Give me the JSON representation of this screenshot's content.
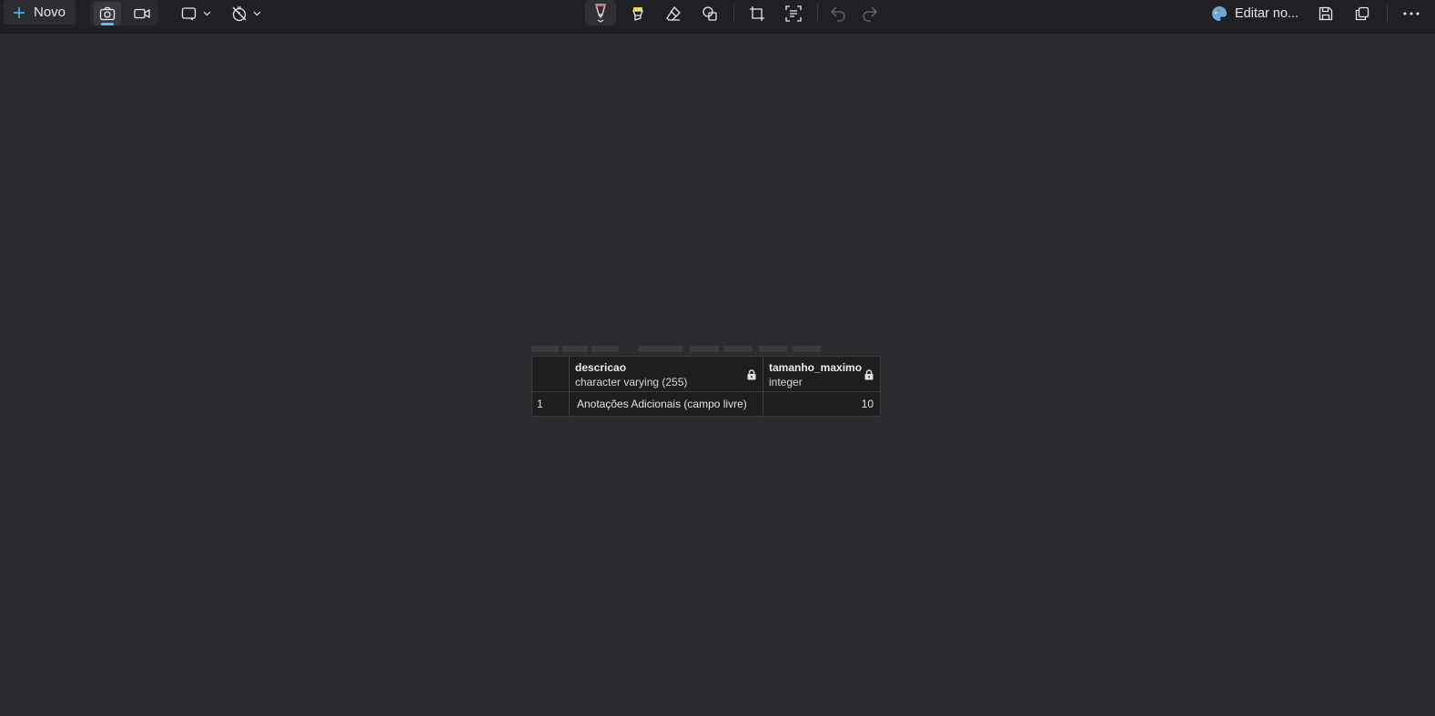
{
  "toolbar": {
    "new_label": "Novo",
    "edit_label": "Editar no...",
    "icons": [
      "plus-icon",
      "camera-icon",
      "video-icon",
      "rectangle-snip-icon",
      "timer-off-icon",
      "ballpoint-pen-icon",
      "highlighter-icon",
      "eraser-icon",
      "shapes-icon",
      "crop-icon",
      "text-actions-icon",
      "undo-icon",
      "redo-icon",
      "paint-palette-icon",
      "save-icon",
      "copy-icon",
      "more-icon"
    ],
    "accent_color": "#4cc2ff"
  },
  "table": {
    "columns": [
      {
        "name": "descricao",
        "type": "character varying (255)"
      },
      {
        "name": "tamanho_maximo",
        "type": "integer"
      }
    ],
    "rows": [
      {
        "row_number": "1",
        "descricao": "Anotações Adicionais (campo livre)",
        "tamanho_maximo": "10"
      }
    ]
  }
}
